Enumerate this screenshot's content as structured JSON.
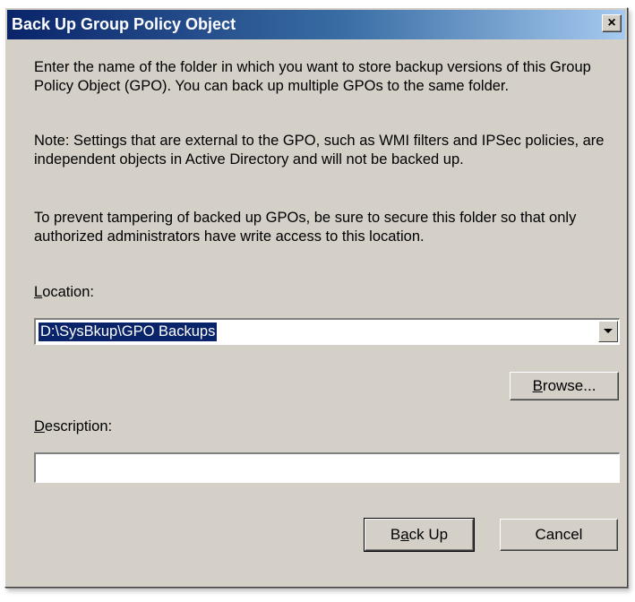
{
  "dialog": {
    "title": "Back Up Group Policy Object",
    "close_label": "×",
    "paragraph1": "Enter the name of the folder in which you want to store backup versions of this Group Policy Object (GPO). You can back up multiple GPOs to the same folder.",
    "paragraph2": "Note: Settings that are external to the GPO, such as WMI filters and IPSec policies, are independent objects in Active Directory and will not be backed up.",
    "paragraph3": "To prevent tampering of backed up GPOs, be sure to secure this folder so that only authorized administrators have write access to this location."
  },
  "location": {
    "label_accel": "L",
    "label_rest": "ocation:",
    "value": "D:\\SysBkup\\GPO Backups"
  },
  "browse": {
    "accel": "B",
    "rest": "rowse..."
  },
  "description": {
    "label_accel": "D",
    "label_rest": "escription:",
    "value": ""
  },
  "buttons": {
    "backup_pre": "B",
    "backup_accel": "a",
    "backup_rest": "ck Up",
    "cancel": "Cancel"
  },
  "colors": {
    "title_gradient_start": "#0a246a",
    "title_gradient_end": "#a6caf0",
    "dialog_face": "#d4d0c8",
    "selection": "#0a246a"
  },
  "icons": [
    "close-icon",
    "dropdown-arrow-icon"
  ]
}
